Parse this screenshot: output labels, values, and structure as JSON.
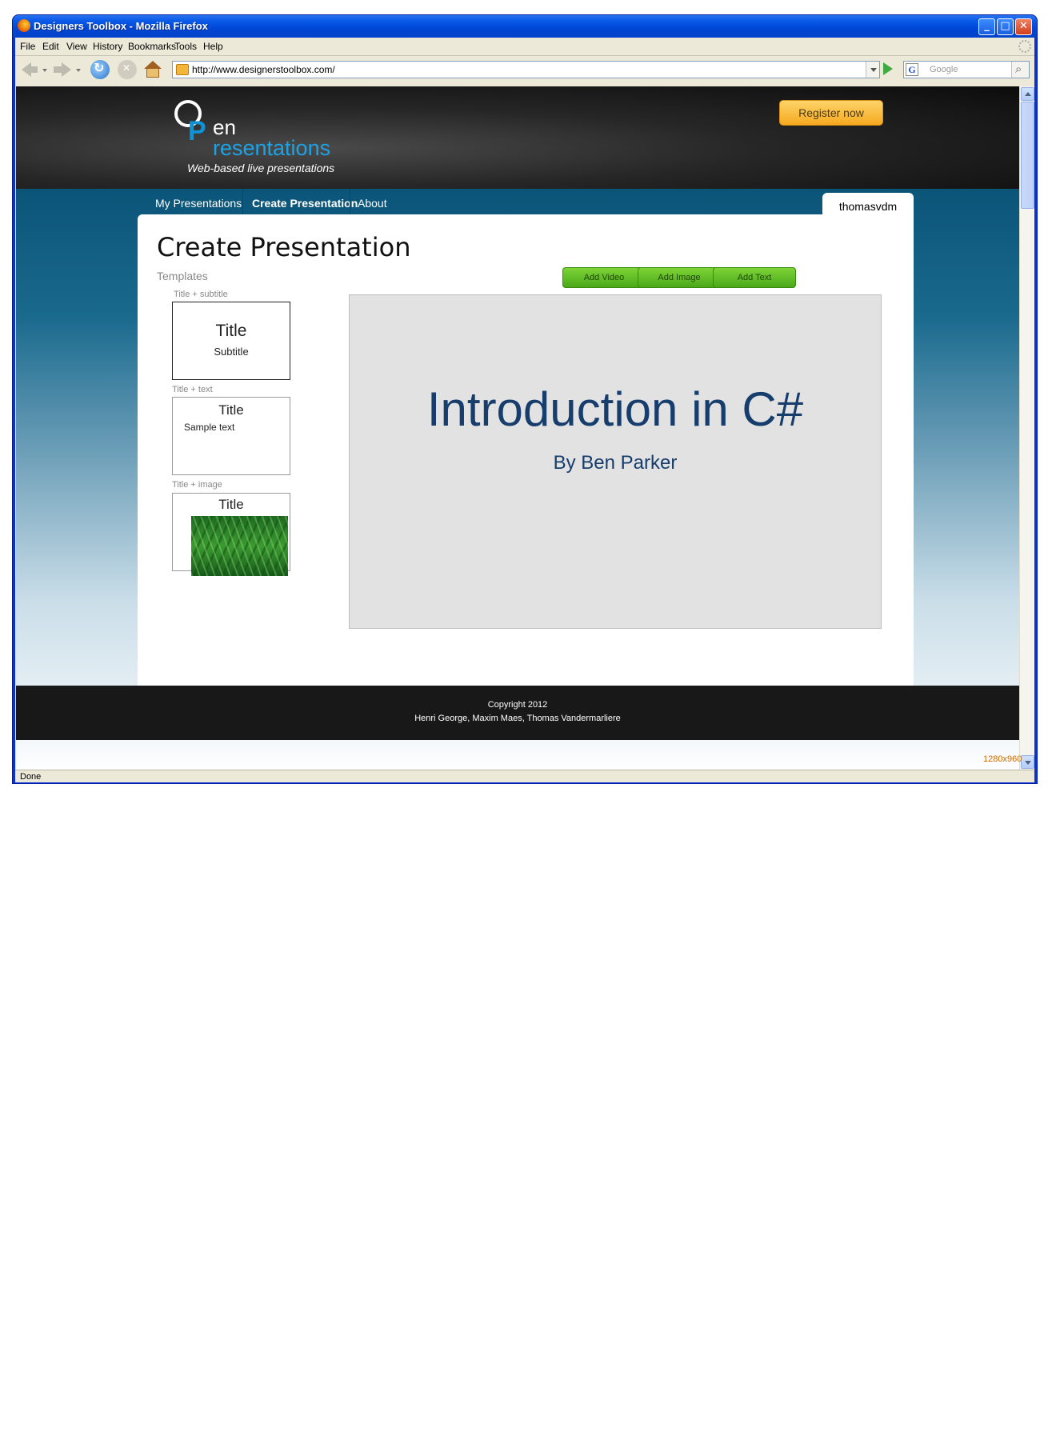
{
  "window": {
    "title": "Designers Toolbox  - Mozilla Firefox"
  },
  "menu": [
    "File",
    "Edit",
    "View",
    "History",
    "Bookmarks",
    "Tools",
    "Help"
  ],
  "toolbar": {
    "url": "http://www.designerstoolbox.com/",
    "search_placeholder": "Google"
  },
  "site": {
    "logo": {
      "o": "O",
      "p": "P",
      "en": "en",
      "rest": "resentations",
      "tagline": "Web-based live presentations"
    },
    "register_label": "Register now",
    "nav": [
      "My Presentations",
      "Create Presentation",
      "About"
    ],
    "active_nav": "Create Presentation",
    "user": "thomasvdm"
  },
  "editor": {
    "heading": "Create Presentation",
    "templates_label": "Templates",
    "buttons": [
      "Add Video",
      "Add Image",
      "Add Text"
    ],
    "templates": [
      {
        "label": "Title + subtitle",
        "title": "Title",
        "subtitle": "Subtitle"
      },
      {
        "label": "Title + text",
        "title": "Title",
        "body": "Sample text"
      },
      {
        "label": "Title + image",
        "title": "Title",
        "image": "grass"
      }
    ],
    "slide": {
      "title": "Introduction in C#",
      "subtitle": "By Ben Parker"
    }
  },
  "footer": {
    "copyright": "Copyright 2012",
    "authors": "Henri George, Maxim Maes, Thomas Vandermarliere"
  },
  "status": {
    "text": "Done",
    "resolution": "1280x960"
  },
  "colors": {
    "brand_blue": "#1ba3e6",
    "nav_teal": "#0a5478",
    "button_green": "#4aa81a",
    "register_orange": "#f6a91f",
    "slide_text": "#163d6c"
  }
}
